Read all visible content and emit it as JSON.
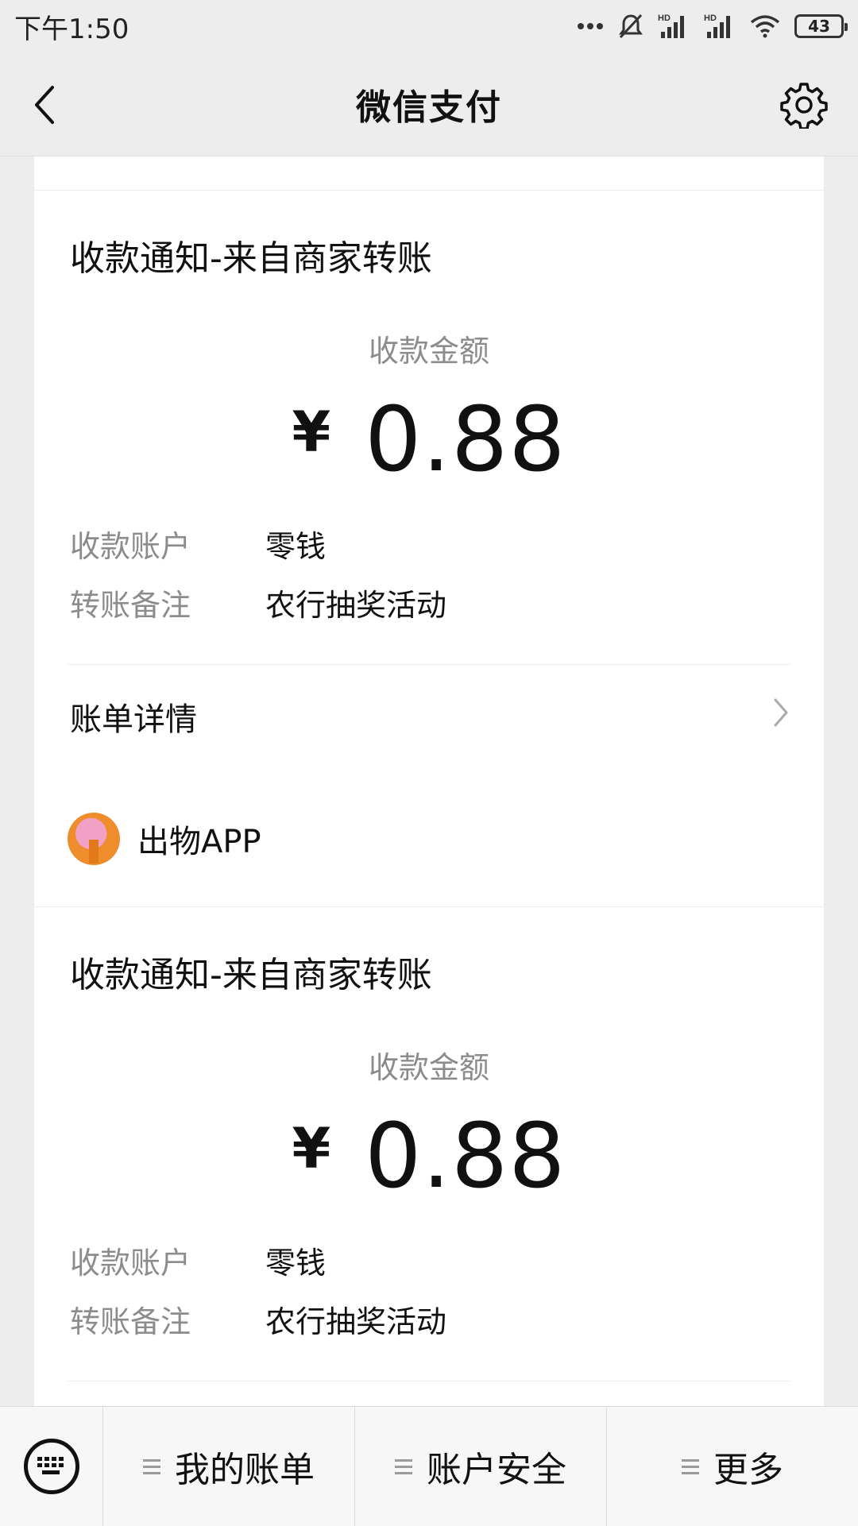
{
  "status_bar": {
    "time": "下午1:50",
    "battery": "43",
    "icons": [
      "more-dots-icon",
      "mute-bell-icon",
      "signal-hd-icon",
      "signal-hd-icon",
      "wifi-icon",
      "battery-icon"
    ]
  },
  "nav": {
    "title": "微信支付",
    "back_icon": "chevron-left-icon",
    "settings_icon": "gear-icon"
  },
  "cards": [
    {
      "title": "收款通知-来自商家转账",
      "amount_label": "收款金额",
      "currency": "¥",
      "amount": "0.88",
      "rows": [
        {
          "key": "收款账户",
          "value": "零钱"
        },
        {
          "key": "转账备注",
          "value": "农行抽奖活动"
        }
      ],
      "detail_label": "账单详情"
    },
    {
      "merchant": "出物APP",
      "title": "收款通知-来自商家转账",
      "amount_label": "收款金额",
      "currency": "¥",
      "amount": "0.88",
      "rows": [
        {
          "key": "收款账户",
          "value": "零钱"
        },
        {
          "key": "转账备注",
          "value": "农行抽奖活动"
        }
      ]
    }
  ],
  "bottom_menu": {
    "keyboard_icon": "keyboard-icon",
    "items": [
      {
        "label": "我的账单"
      },
      {
        "label": "账户安全"
      },
      {
        "label": "更多"
      }
    ]
  },
  "colors": {
    "background": "#ededed",
    "card": "#ffffff",
    "secondary_text": "#8c8c8c",
    "primary_text": "#111111"
  }
}
